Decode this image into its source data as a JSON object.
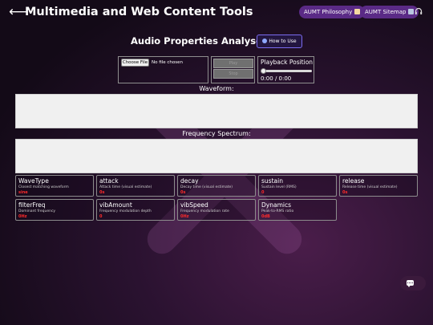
{
  "header": {
    "back_icon": "left-arrow-icon",
    "site_title": "Multimedia and Web Content Tools",
    "philosophy_label": "AUMT Philosophy",
    "philosophy_icon": "scroll-icon",
    "sitemap_label": "AUMT Sitemap",
    "sitemap_icon": "map-icon",
    "audio_icon": "headphones-icon"
  },
  "main": {
    "title": "Audio Properties Analyser",
    "howto_label": "How to Use",
    "howto_icon": "info-icon"
  },
  "file_input": {
    "button_label": "Choose File",
    "status": "No file chosen"
  },
  "controls": {
    "play_label": "Play",
    "stop_label": "Stop"
  },
  "playback": {
    "label": "Playback Position",
    "time": "0:00 / 0:00",
    "position_fraction": 0
  },
  "sections": {
    "waveform_label": "Waveform:",
    "spectrum_label": "Frequency Spectrum:"
  },
  "cards": [
    {
      "title": "WaveType",
      "desc": "Closest matching waveform",
      "value": "sine"
    },
    {
      "title": "attack",
      "desc": "Attack time (visual estimate)",
      "value": "0s"
    },
    {
      "title": "decay",
      "desc": "Decay time (visual estimate)",
      "value": "0s"
    },
    {
      "title": "sustain",
      "desc": "Sustain level (RMS)",
      "value": "0"
    },
    {
      "title": "release",
      "desc": "Release time (visual estimate)",
      "value": "0s"
    },
    {
      "title": "filterFreq",
      "desc": "Dominant frequency",
      "value": "0Hz"
    },
    {
      "title": "vibAmount",
      "desc": "Frequency modulation depth",
      "value": "0"
    },
    {
      "title": "vibSpeed",
      "desc": "Frequency modulation rate",
      "value": "0Hz"
    },
    {
      "title": "Dynamics",
      "desc": "Peak-to-RMS ratio",
      "value": "0dB"
    }
  ],
  "chat": {
    "icon": "chat-bubble-icon"
  },
  "colors": {
    "accent_purple": "#5a2a86",
    "value_red": "#ff2b2b",
    "howto_border": "#7b6cf0",
    "panel_bg": "#f0f0f0"
  }
}
